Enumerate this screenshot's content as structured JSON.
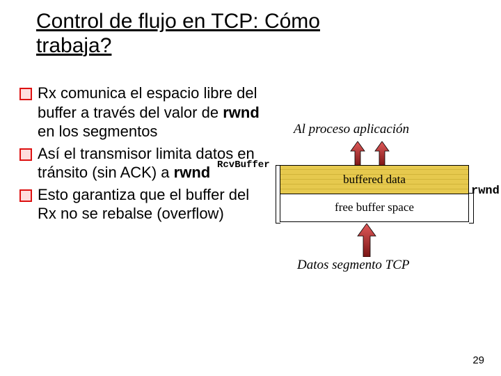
{
  "title": "Control de flujo en TCP: Cómo trabaja?",
  "bullets": [
    {
      "pre": "Rx comunica el espacio libre del buffer a través del valor de ",
      "bold": "rwnd",
      "post": " en los segmentos"
    },
    {
      "pre": "Así el transmisor limita datos en tránsito (sin ACK) a ",
      "bold": "rwnd",
      "post": ""
    },
    {
      "pre": "Esto garantiza que el buffer del Rx no se rebalse (overflow)",
      "bold": "",
      "post": ""
    }
  ],
  "diagram": {
    "app_label": "Al proceso aplicación",
    "rcv_buffer_label": "RcvBuffer",
    "buffered_label": "buffered data",
    "free_label": "free buffer space",
    "rwnd_label": "rwnd",
    "tcp_label": "Datos segmento TCP"
  },
  "page_number": "29"
}
